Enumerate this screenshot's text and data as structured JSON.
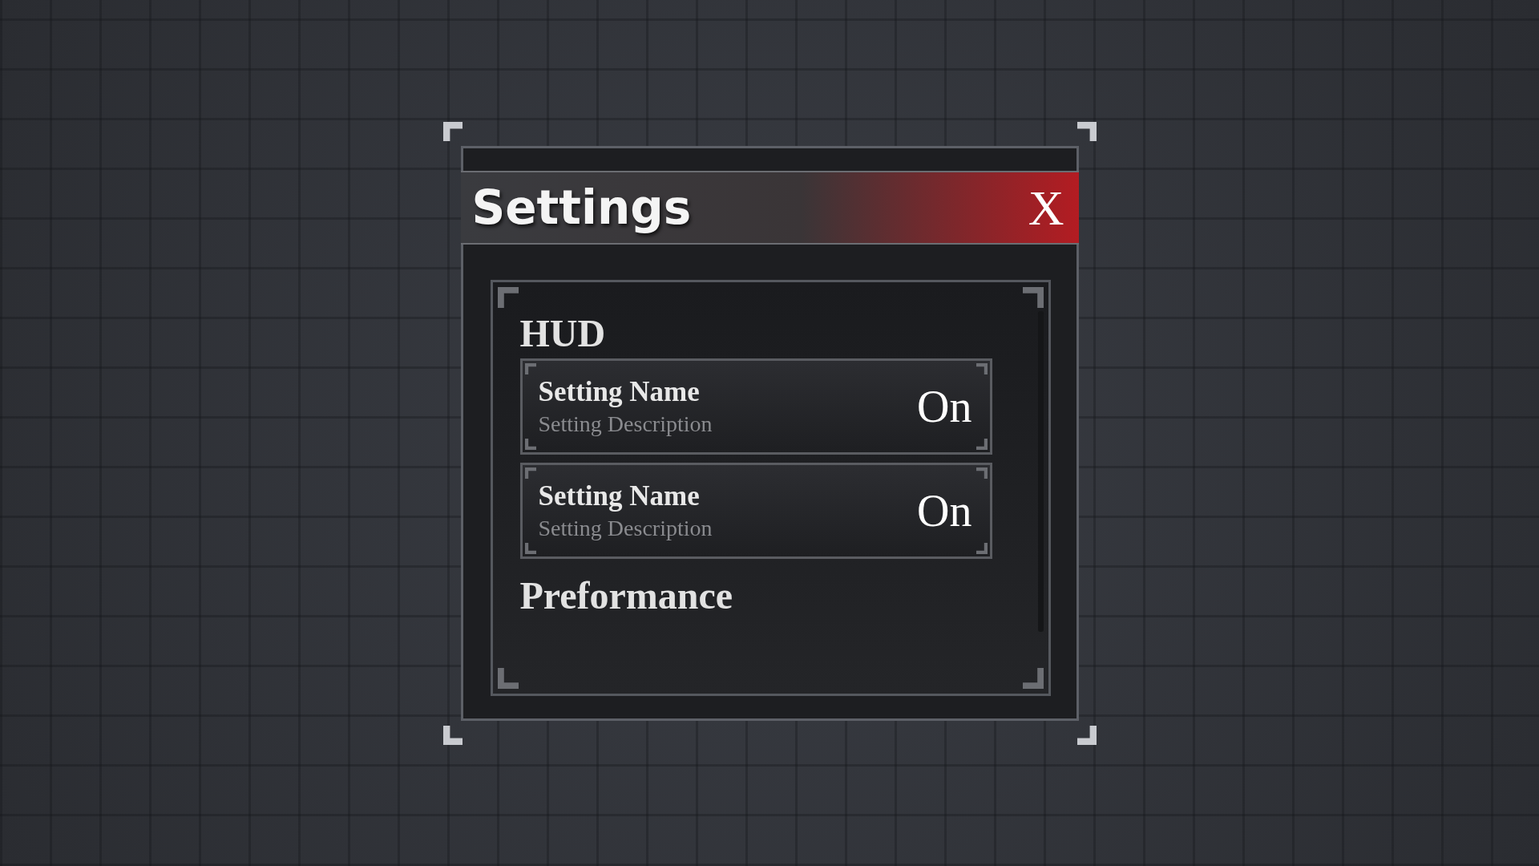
{
  "window": {
    "title": "Settings",
    "close_label": "X"
  },
  "sections": [
    {
      "heading": "HUD",
      "settings": [
        {
          "name": "Setting Name",
          "description": "Setting Description",
          "value": "On"
        },
        {
          "name": "Setting Name",
          "description": "Setting Description",
          "value": "On"
        }
      ]
    },
    {
      "heading": "Preformance"
    }
  ]
}
